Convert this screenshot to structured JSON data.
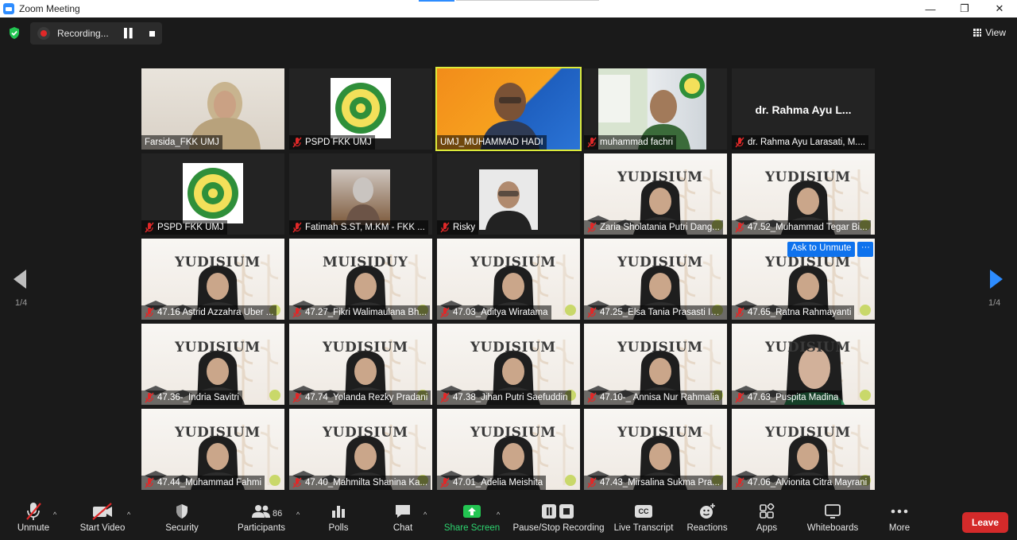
{
  "window": {
    "title": "Zoom Meeting",
    "controls": [
      "—",
      "❐",
      "✕"
    ]
  },
  "topbar": {
    "recording_label": "Recording...",
    "view_label": "View"
  },
  "pagination": {
    "left": "1/4",
    "right": "1/4"
  },
  "participants": [
    {
      "name": "Farsida_FKK UMJ",
      "muted": false,
      "kind": "woman-hijab"
    },
    {
      "name": "PSPD FKK UMJ",
      "muted": true,
      "kind": "logo"
    },
    {
      "name": "UMJ_MUHAMMAD HADI",
      "muted": false,
      "kind": "orange-bg",
      "active": true
    },
    {
      "name": "muhammad fachri",
      "muted": true,
      "kind": "banner-bg"
    },
    {
      "name": "dr. Rahma Ayu Larasati, M....",
      "muted": true,
      "kind": "name-only",
      "display_name": "dr. Rahma Ayu L..."
    },
    {
      "name": "PSPD FKK UMJ",
      "muted": true,
      "kind": "logo"
    },
    {
      "name": "Fatimah S.ST, M.KM - FKK ...",
      "muted": true,
      "kind": "photo-small"
    },
    {
      "name": "Risky",
      "muted": true,
      "kind": "photo-man"
    },
    {
      "name": "Zaria Sholatania Putri Dang...",
      "muted": true,
      "kind": "yudisium"
    },
    {
      "name": "47.52_Muhammad Tegar Bi...",
      "muted": true,
      "kind": "yudisium"
    },
    {
      "name": "47.16 Astrid Azzahra Uber ...",
      "muted": true,
      "kind": "yudisium"
    },
    {
      "name": "47.27_Fikri Walimaulana Bh...",
      "muted": true,
      "kind": "yudisium-mirror"
    },
    {
      "name": "47.03_Aditya Wiratama",
      "muted": true,
      "kind": "yudisium"
    },
    {
      "name": "47.25_Elsa Tania Prasasti Isl...",
      "muted": true,
      "kind": "yudisium"
    },
    {
      "name": "47.65_Ratna Rahmayanti",
      "muted": true,
      "kind": "yudisium"
    },
    {
      "name": "47.36-_Indria Savitri",
      "muted": true,
      "kind": "yudisium"
    },
    {
      "name": "47.74_Yolanda Rezky Pradani",
      "muted": true,
      "kind": "yudisium"
    },
    {
      "name": "47.38_Jihan Putri Saefuddin",
      "muted": true,
      "kind": "yudisium"
    },
    {
      "name": "47.10-_ Annisa Nur Rahmalia",
      "muted": true,
      "kind": "yudisium"
    },
    {
      "name": "47.63_Puspita Madina",
      "muted": true,
      "kind": "yudisium-close"
    },
    {
      "name": "47.44_Muhammad Fahmi",
      "muted": true,
      "kind": "yudisium"
    },
    {
      "name": "47.40_Mahmilta Shanina Ka...",
      "muted": true,
      "kind": "yudisium"
    },
    {
      "name": "47.01_Adelia Meishita",
      "muted": true,
      "kind": "yudisium"
    },
    {
      "name": "47.43_Mirsalina Sukma Pra...",
      "muted": true,
      "kind": "yudisium"
    },
    {
      "name": "47.06_Alvionita Citra Mayrani",
      "muted": true,
      "kind": "yudisium"
    }
  ],
  "tile_text": {
    "yudisium": "YUDISIUM",
    "yudisium_mirror": "MUISIDUY"
  },
  "popup": {
    "ask_label": "Ask to Unmute",
    "more": "···"
  },
  "toolbar": {
    "unmute": "Unmute",
    "start_video": "Start Video",
    "security": "Security",
    "participants": "Participants",
    "participants_count": "86",
    "polls": "Polls",
    "chat": "Chat",
    "share_screen": "Share Screen",
    "pause_stop_recording": "Pause/Stop Recording",
    "live_transcript": "Live Transcript",
    "cc": "CC",
    "reactions": "Reactions",
    "apps": "Apps",
    "whiteboards": "Whiteboards",
    "more": "More",
    "leave": "Leave"
  },
  "colors": {
    "accent_blue": "#2d8cff",
    "active_speaker": "#dcea3a",
    "leave_red": "#d42a2a",
    "share_green": "#2dd36f",
    "muted_red": "#e02828"
  }
}
